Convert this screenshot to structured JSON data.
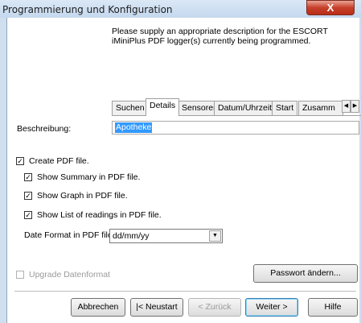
{
  "window": {
    "title": "Programmierung und Konfiguration",
    "close_label": "X"
  },
  "description_text": "Please supply an appropriate description for the ESCORT iMiniPlus PDF logger(s) currently being programmed.",
  "tabs": [
    {
      "label": "Suchen",
      "active": false
    },
    {
      "label": "Details",
      "active": true
    },
    {
      "label": "Sensoren",
      "active": false
    },
    {
      "label": "Datum/Uhrzeit",
      "active": false
    },
    {
      "label": "Start",
      "active": false
    },
    {
      "label": "Zusamm",
      "active": false
    }
  ],
  "tab_scroll": {
    "left": "◀",
    "right": "▶"
  },
  "beschreibung": {
    "label": "Beschreibung:",
    "value": "Apotheke"
  },
  "checkboxes": {
    "create_pdf": {
      "label": "Create PDF file.",
      "checked": true,
      "mark": "✓"
    },
    "show_summary": {
      "label": "Show Summary in PDF file.",
      "checked": true,
      "mark": "✓"
    },
    "show_graph": {
      "label": "Show Graph in PDF file.",
      "checked": true,
      "mark": "✓"
    },
    "show_list": {
      "label": "Show List of readings in PDF file.",
      "checked": true,
      "mark": "✓"
    },
    "upgrade": {
      "label": "Upgrade Datenformat",
      "checked": false,
      "enabled": false
    }
  },
  "date_format": {
    "label": "Date Format in PDF file:",
    "value": "dd/mm/yy",
    "arrow": "▼"
  },
  "buttons": {
    "passwort": "Passwort ändern...",
    "abbrechen": "Abbrechen",
    "neustart": "|< Neustart",
    "zurueck": "< Zurück",
    "weiter": "Weiter >",
    "hilfe": "Hilfe"
  },
  "colors": {
    "selection": "#3399ff",
    "close": "#c7402a",
    "frame": "#cfdff0"
  }
}
